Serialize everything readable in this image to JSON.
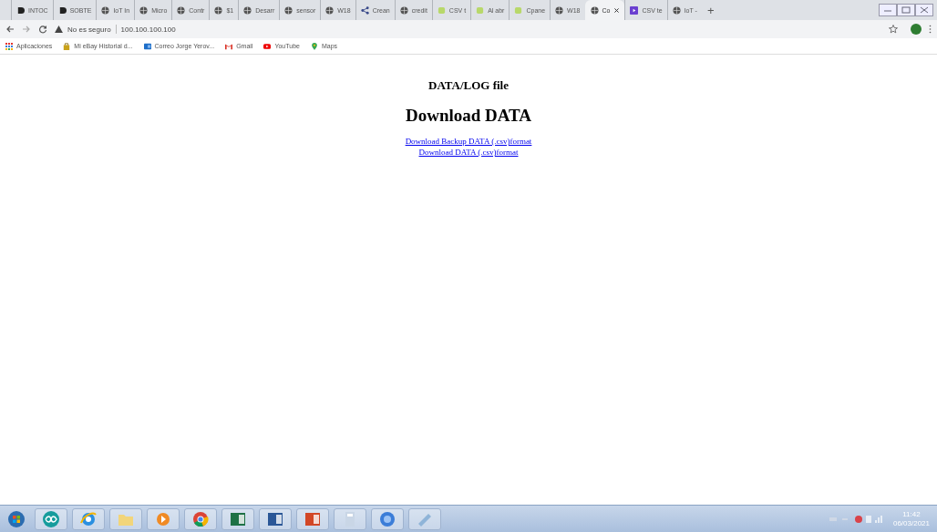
{
  "tabs": [
    {
      "title": "INTOC",
      "kind": "letter",
      "selected": false
    },
    {
      "title": "SOBTE",
      "kind": "letter",
      "selected": false
    },
    {
      "title": "IoT In",
      "kind": "globe",
      "selected": false
    },
    {
      "title": "Micro",
      "kind": "globe",
      "selected": false
    },
    {
      "title": "Contr",
      "kind": "globe",
      "selected": false
    },
    {
      "title": "$1",
      "kind": "globe",
      "selected": false
    },
    {
      "title": "Desarr",
      "kind": "globe",
      "selected": false
    },
    {
      "title": "sensor",
      "kind": "globe",
      "selected": false
    },
    {
      "title": "W18",
      "kind": "globe",
      "selected": false
    },
    {
      "title": "Crean",
      "kind": "share",
      "selected": false
    },
    {
      "title": "credit",
      "kind": "globe",
      "selected": false
    },
    {
      "title": "CSV t",
      "kind": "leaf",
      "selected": false
    },
    {
      "title": "Al abr",
      "kind": "leaf",
      "selected": false
    },
    {
      "title": "Cpane",
      "kind": "leaf",
      "selected": false
    },
    {
      "title": "W18",
      "kind": "globe",
      "selected": false
    },
    {
      "title": "Co",
      "kind": "globe",
      "selected": true
    },
    {
      "title": "CSV te",
      "kind": "square",
      "selected": false
    },
    {
      "title": "IoT - ",
      "kind": "globe",
      "selected": false
    }
  ],
  "new_tab": "+",
  "address_bar": {
    "security": "No es seguro",
    "url": "100.100.100.100"
  },
  "bookmarks": [
    {
      "label": "Aplicaciones",
      "kind": "apps"
    },
    {
      "label": "Mi eBay Historial d...",
      "kind": "bag"
    },
    {
      "label": "Correo Jorge Yerov...",
      "kind": "mail"
    },
    {
      "label": "Gmail",
      "kind": "gmail"
    },
    {
      "label": "YouTube",
      "kind": "video"
    },
    {
      "label": "Maps",
      "kind": "pin"
    }
  ],
  "page": {
    "subtitle": "DATA/LOG file",
    "heading": "Download DATA",
    "links": [
      "Download Backup DATA (.csv)format",
      "Download DATA (.csv)format"
    ]
  },
  "taskbar": {
    "apps": [
      {
        "kind": "start"
      },
      {
        "kind": "infinity"
      },
      {
        "kind": "ie"
      },
      {
        "kind": "folder"
      },
      {
        "kind": "media"
      },
      {
        "kind": "chrome"
      },
      {
        "kind": "excel"
      },
      {
        "kind": "word"
      },
      {
        "kind": "powerpoint"
      },
      {
        "kind": "calc"
      },
      {
        "kind": "circle"
      },
      {
        "kind": "tool"
      }
    ],
    "time": "11:42",
    "date": "06/03/2021"
  }
}
